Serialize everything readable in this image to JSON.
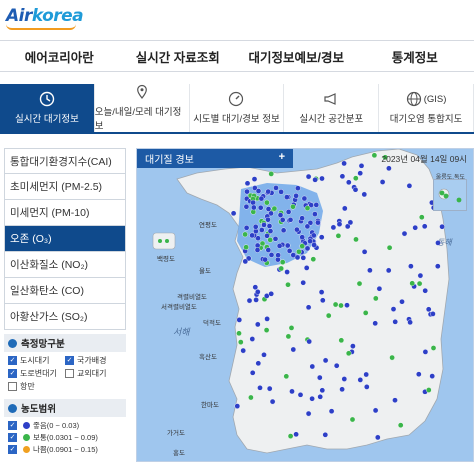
{
  "brand": {
    "logo_air": "Air",
    "logo_korea": "korea"
  },
  "gnb": [
    "에어코리아란",
    "실시간 자료조회",
    "대기정보예보/경보",
    "통계정보"
  ],
  "subnav": [
    {
      "label": "실시간 대기정보",
      "icon": "clock-icon",
      "active": true
    },
    {
      "label": "오늘/내일/모레 대기정보",
      "icon": "location-pin-icon",
      "active": false
    },
    {
      "label": "시도별 대기/경보 정보",
      "icon": "gauge-icon",
      "active": false
    },
    {
      "label": "실시간 공간분포",
      "icon": "megaphone-icon",
      "active": false
    },
    {
      "label": "대기오염 통합지도",
      "prefix": "(GIS)",
      "icon": "globe-icon",
      "active": false
    }
  ],
  "sidebar": {
    "items": [
      {
        "label": "통합대기환경지수(CAI)",
        "active": false
      },
      {
        "label": "초미세먼지 (PM-2.5)",
        "active": false
      },
      {
        "label": "미세먼지 (PM-10)",
        "active": false
      },
      {
        "label": "오존 (O₃)",
        "active": true
      },
      {
        "label": "이산화질소 (NO₂)",
        "active": false
      },
      {
        "label": "일산화탄소 (CO)",
        "active": false
      },
      {
        "label": "아황산가스 (SO₂)",
        "active": false
      }
    ],
    "network_title": "측정망구분",
    "network_checks": [
      {
        "label": "도시대기",
        "checked": true
      },
      {
        "label": "국가배경",
        "checked": true
      },
      {
        "label": "도로변대기",
        "checked": true
      },
      {
        "label": "교외대기",
        "checked": false
      },
      {
        "label": "항만",
        "checked": false
      }
    ],
    "range_title": "농도범위",
    "range_legend": [
      {
        "label": "좋음(0 ~ 0.03)",
        "color": "#2d3fc7",
        "checked": true
      },
      {
        "label": "보통(0.0301 ~ 0.09)",
        "color": "#3ab54a",
        "checked": true
      },
      {
        "label": "나쁨(0.0901 ~ 0.15)",
        "color": "#f0a020",
        "checked": true
      }
    ]
  },
  "map": {
    "panel_title": "대기질 경보",
    "plus": "+",
    "timestamp": "2023년 04월 14일 09시",
    "inset_label": "울릉도,독도",
    "labels": [
      "연평도",
      "백령도",
      "율도",
      "격렬비열도",
      "서격렬비열도",
      "덕적도",
      "흑산도",
      "한마도",
      "가거도",
      "홍도"
    ],
    "sea_label_w": "서해",
    "sea_label_e": "동해",
    "colors": {
      "good": "#2d3fc7",
      "normal": "#3ab54a",
      "land": "#eef0f1",
      "sea": "#9fc6ee",
      "warn_region": "#6ea8ea"
    }
  }
}
